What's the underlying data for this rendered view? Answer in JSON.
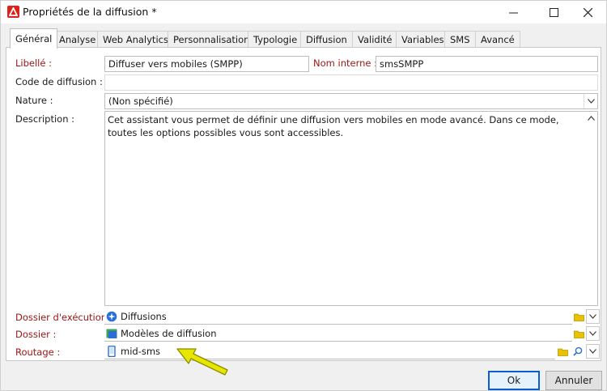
{
  "window": {
    "title": "Propriétés de la diffusion *"
  },
  "tabs": [
    {
      "label": "Général",
      "active": true
    },
    {
      "label": "Analyse"
    },
    {
      "label": "Web Analytics"
    },
    {
      "label": "Personnalisation"
    },
    {
      "label": "Typologie"
    },
    {
      "label": "Diffusion"
    },
    {
      "label": "Validité"
    },
    {
      "label": "Variables"
    },
    {
      "label": "SMS"
    },
    {
      "label": "Avancé"
    }
  ],
  "form": {
    "libelle_label": "Libellé :",
    "libelle_value": "Diffuser vers mobiles (SMPP)",
    "nom_interne_label": "Nom interne :",
    "nom_interne_value": "smsSMPP",
    "code_label": "Code de diffusion :",
    "code_value": "",
    "nature_label": "Nature :",
    "nature_value": "(Non spécifié)",
    "description_label": "Description :",
    "description_value": "Cet assistant vous permet de définir une diffusion vers mobiles en mode avancé. Dans ce mode, toutes les options possibles vous sont accessibles.",
    "dossier_exec_label": "Dossier d'exécution :",
    "dossier_exec_value": "Diffusions",
    "dossier_label": "Dossier :",
    "dossier_value": "Modèles de diffusion",
    "routage_label": "Routage :",
    "routage_value": "mid-sms"
  },
  "buttons": {
    "ok": "Ok",
    "cancel": "Annuler"
  },
  "colors": {
    "accent": "#0a5fd0",
    "required_label": "#9b1414",
    "app_icon": "#e0201b",
    "annotation_arrow": "#e6e600"
  },
  "icons": {
    "app": "app-logo-icon",
    "minimize": "minimize-icon",
    "maximize": "maximize-icon",
    "close": "close-icon",
    "folder": "folder-icon",
    "search": "search-icon",
    "chevron": "chevron-down-icon",
    "routing": "mobile-icon"
  }
}
